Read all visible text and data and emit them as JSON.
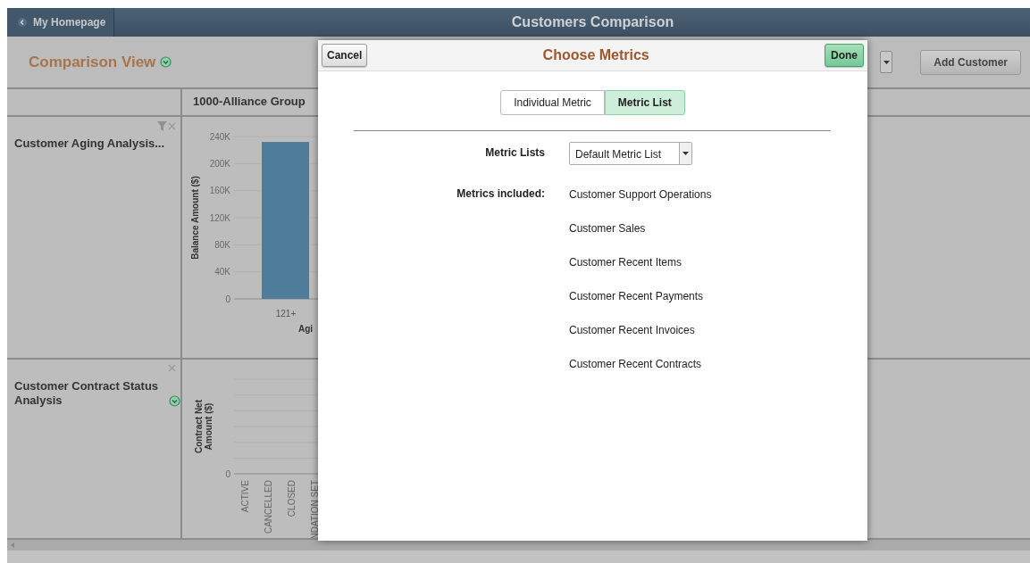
{
  "header": {
    "back_button": "My Homepage",
    "title": "Customers Comparison"
  },
  "toolbar": {
    "title": "Comparison View",
    "add_button": "Add Customer"
  },
  "grid": {
    "column_header": "1000-Alliance Group",
    "rows": [
      {
        "title": "Customer Aging Analysis...",
        "has_filter": true,
        "has_menu": false,
        "chart_data": {
          "type": "bar",
          "ylabel": "Balance Amount ($)",
          "xlabel": "Agi",
          "categories": [
            "121+"
          ],
          "values": [
            232000
          ],
          "ylim": [
            0,
            240000
          ],
          "grid": true,
          "yticks": [
            {
              "value": 0,
              "label": "0"
            },
            {
              "value": 40000,
              "label": "40K"
            },
            {
              "value": 80000,
              "label": "80K"
            },
            {
              "value": 120000,
              "label": "120K"
            },
            {
              "value": 160000,
              "label": "160K"
            },
            {
              "value": 200000,
              "label": "200K"
            },
            {
              "value": 240000,
              "label": "240K"
            }
          ]
        }
      },
      {
        "title": "Customer Contract Status Analysis",
        "has_filter": false,
        "has_menu": true,
        "chart_picture": {
          "ylabel": "Contract Net Amount ($)",
          "tick": "0",
          "categories": [
            "ACTIVE",
            "CANCELLED",
            "CLOSED",
            "NDATION SET"
          ]
        }
      }
    ]
  },
  "dialog": {
    "cancel_button": "Cancel",
    "title": "Choose Metrics",
    "done_button": "Done",
    "tabs": [
      {
        "label": "Individual Metric",
        "selected": false
      },
      {
        "label": "Metric List",
        "selected": true
      }
    ],
    "metric_lists_label": "Metric Lists",
    "metric_list_value": "Default Metric List",
    "metrics_label": "Metrics included:",
    "metrics": [
      "Customer Support Operations",
      "Customer Sales",
      "Customer Recent Items",
      "Customer Recent Payments",
      "Customer Recent Invoices",
      "Customer Recent Contracts"
    ]
  }
}
